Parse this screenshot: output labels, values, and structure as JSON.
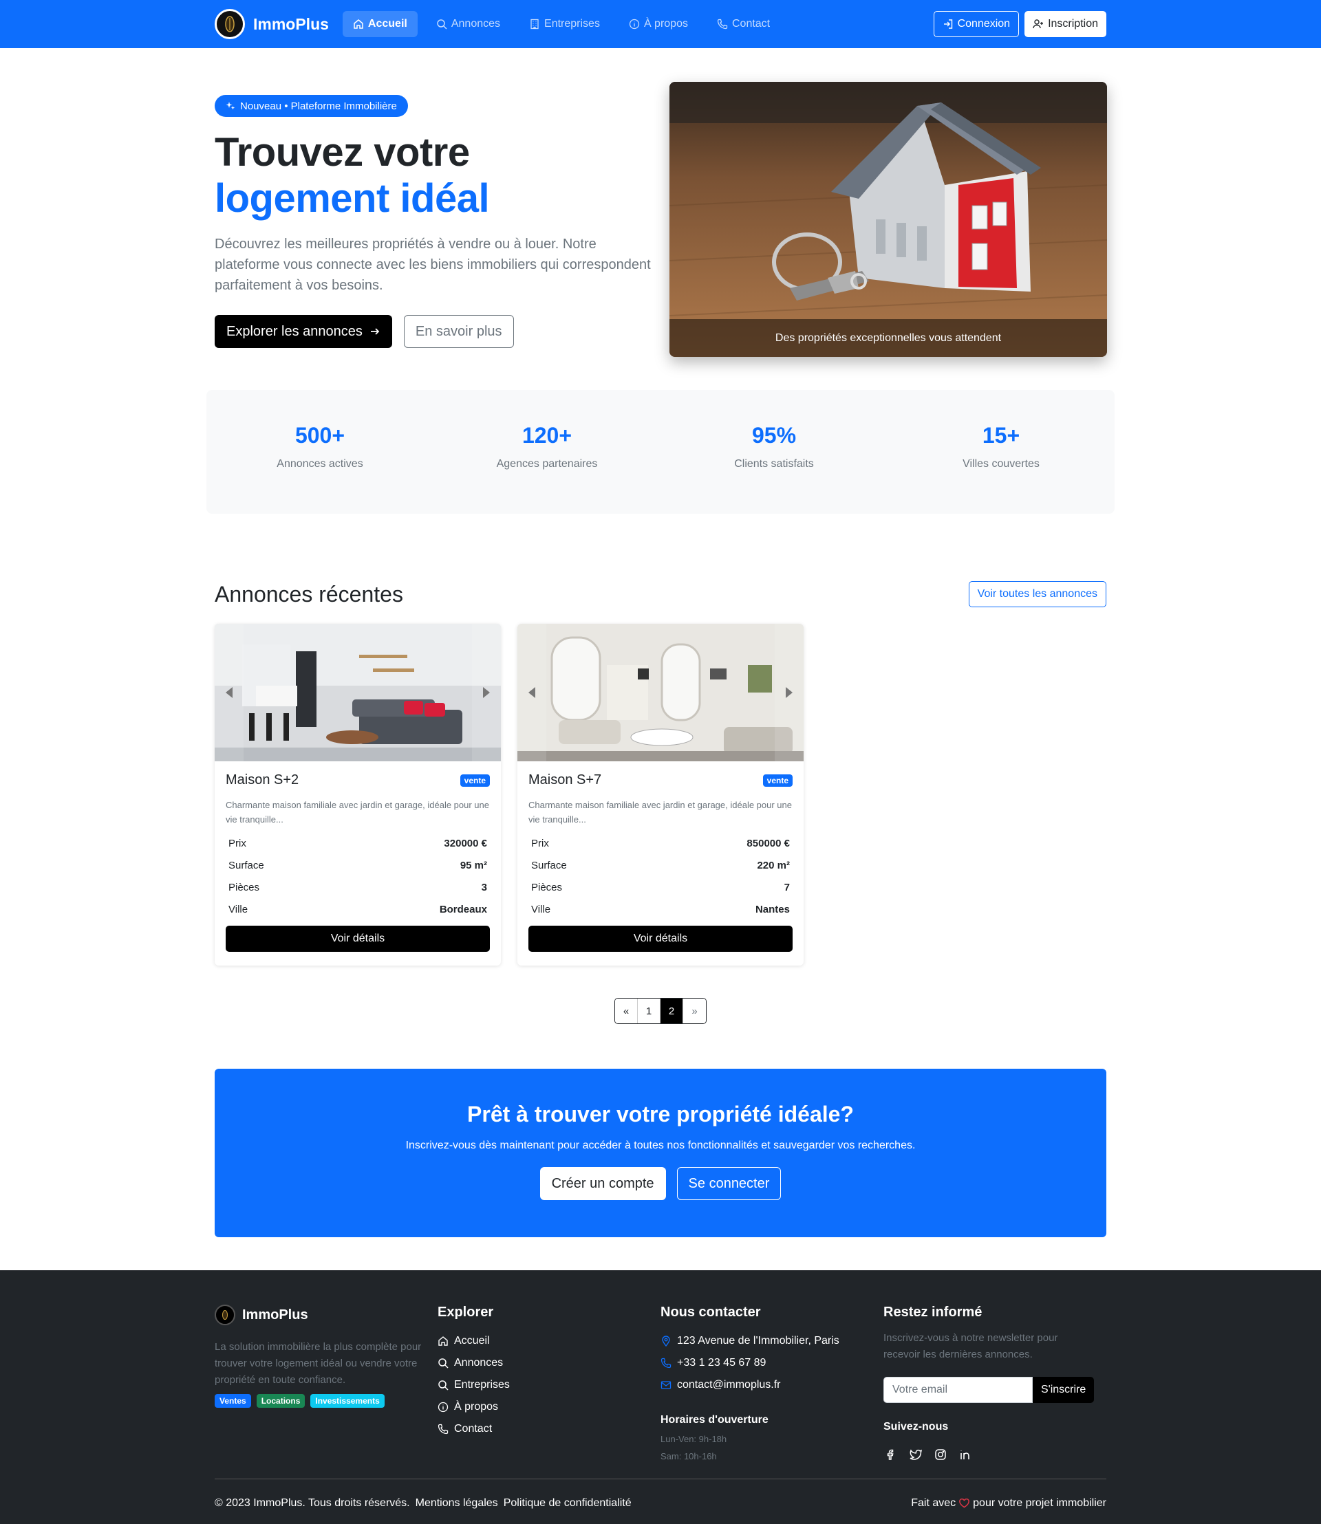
{
  "nav": {
    "brand": "ImmoPlus",
    "links": [
      {
        "label": "Accueil"
      },
      {
        "label": "Annonces"
      },
      {
        "label": "Entreprises"
      },
      {
        "label": "À propos"
      },
      {
        "label": "Contact"
      }
    ],
    "login": "Connexion",
    "signup": "Inscription"
  },
  "hero": {
    "badge": "Nouveau • Plateforme Immobilière",
    "title_a": "Trouvez votre ",
    "title_b": "logement idéal",
    "desc": "Découvrez les meilleures propriétés à vendre ou à louer. Notre plateforme vous connecte avec les biens immobiliers qui correspondent parfaitement à vos besoins.",
    "btn_primary": "Explorer les annonces",
    "btn_secondary": "En savoir plus",
    "caption": "Des propriétés exceptionnelles vous attendent"
  },
  "stats": [
    {
      "num": "500+",
      "label": "Annonces actives"
    },
    {
      "num": "120+",
      "label": "Agences partenaires"
    },
    {
      "num": "95%",
      "label": "Clients satisfaits"
    },
    {
      "num": "15+",
      "label": "Villes couvertes"
    }
  ],
  "recent": {
    "title": "Annonces récentes",
    "all_btn": "Voir toutes les annonces",
    "cards": [
      {
        "title": "Maison S+2",
        "badge": "vente",
        "desc": "Charmante maison familiale avec jardin et garage, idéale pour une vie tranquille...",
        "rows": [
          {
            "k": "Prix",
            "v": "320000 €"
          },
          {
            "k": "Surface",
            "v": "95 m²"
          },
          {
            "k": "Pièces",
            "v": "3"
          },
          {
            "k": "Ville",
            "v": "Bordeaux"
          }
        ],
        "btn": "Voir détails"
      },
      {
        "title": "Maison S+7",
        "badge": "vente",
        "desc": "Charmante maison familiale avec jardin et garage, idéale pour une vie tranquille...",
        "rows": [
          {
            "k": "Prix",
            "v": "850000 €"
          },
          {
            "k": "Surface",
            "v": "220 m²"
          },
          {
            "k": "Pièces",
            "v": "7"
          },
          {
            "k": "Ville",
            "v": "Nantes"
          }
        ],
        "btn": "Voir détails"
      }
    ],
    "pagination": {
      "prev": "«",
      "pages": [
        "1",
        "2"
      ],
      "next": "»",
      "current": "2"
    }
  },
  "cta": {
    "title": "Prêt à trouver votre propriété idéale?",
    "desc": "Inscrivez-vous dès maintenant pour accéder à toutes nos fonctionnalités et sauvegarder vos recherches.",
    "btn_create": "Créer un compte",
    "btn_login": "Se connecter"
  },
  "footer": {
    "brand": "ImmoPlus",
    "desc": "La solution immobilière la plus complète pour trouver votre logement idéal ou vendre votre propriété en toute confiance.",
    "tags": [
      "Ventes",
      "Locations",
      "Investissements"
    ],
    "explore_title": "Explorer",
    "explore": [
      "Accueil",
      "Annonces",
      "Entreprises",
      "À propos",
      "Contact"
    ],
    "contact_title": "Nous contacter",
    "address": "123 Avenue de l'Immobilier, Paris",
    "phone": "+33 1 23 45 67 89",
    "email": "contact@immoplus.fr",
    "hours_title": "Horaires d'ouverture",
    "hours": [
      "Lun-Ven: 9h-18h",
      "Sam: 10h-16h"
    ],
    "news_title": "Restez informé",
    "news_desc": "Inscrivez-vous à notre newsletter pour recevoir les dernières annonces.",
    "news_placeholder": "Votre email",
    "news_btn": "S'inscrire",
    "follow": "Suivez-nous",
    "copyright": "© 2023 ImmoPlus. Tous droits réservés.",
    "legal": "Mentions légales",
    "privacy": "Politique de confidentialité",
    "made_a": "Fait avec",
    "made_b": "pour votre projet immobilier"
  },
  "colors": {
    "primary": "#0d6efd",
    "dark": "#212529",
    "muted": "#6c757d",
    "success": "#198754",
    "info": "#0dcaf0"
  }
}
